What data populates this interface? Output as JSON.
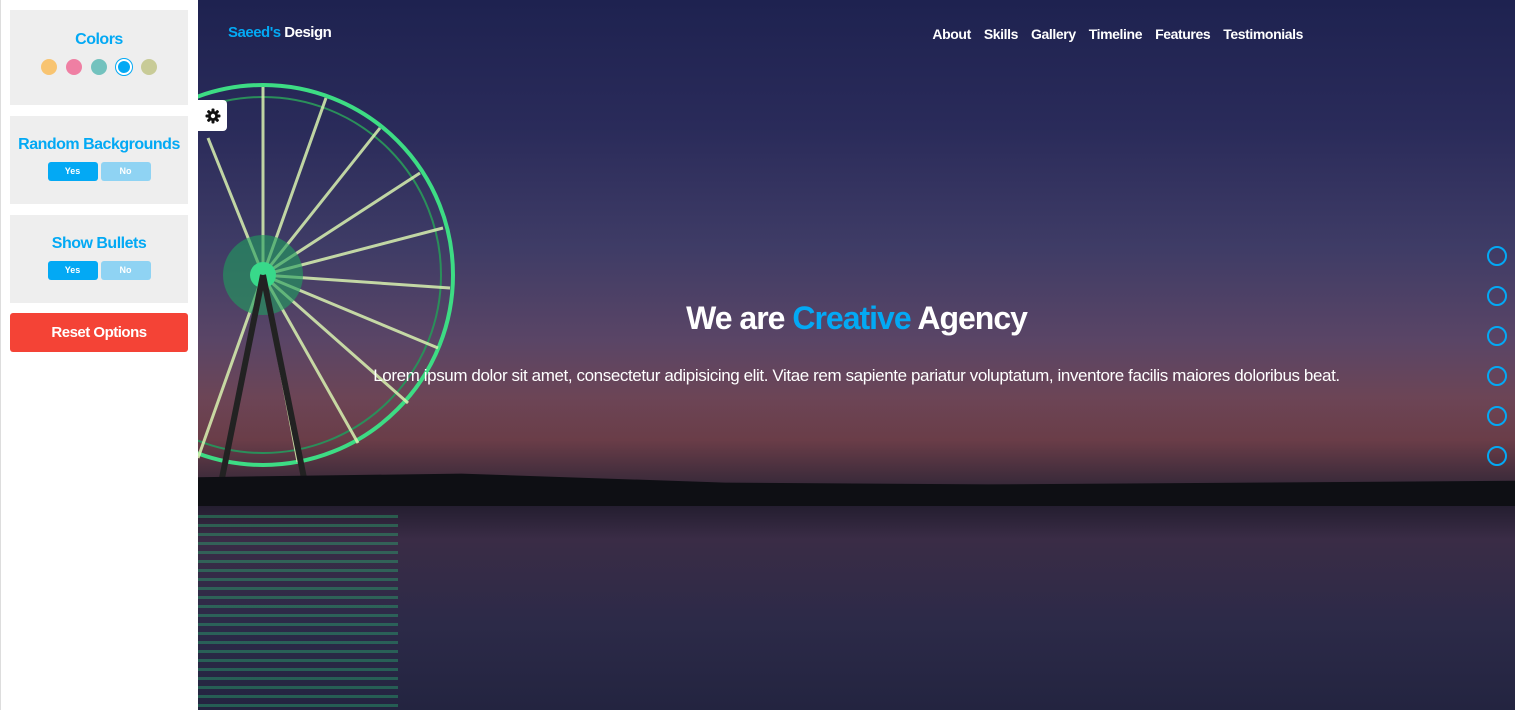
{
  "settings": {
    "colors": {
      "title": "Colors",
      "swatches": [
        "#f8c471",
        "#ef7fa3",
        "#73c2be",
        "#03a9f4",
        "#c8cb97"
      ],
      "active_index": 3
    },
    "random_backgrounds": {
      "title": "Random Backgrounds",
      "yes": "Yes",
      "no": "No"
    },
    "show_bullets": {
      "title": "Show Bullets",
      "yes": "Yes",
      "no": "No"
    },
    "reset_label": "Reset Options"
  },
  "header": {
    "logo_accent": "Saeed's",
    "logo_rest": "Design",
    "nav": [
      "About",
      "Skills",
      "Gallery",
      "Timeline",
      "Features",
      "Testimonials"
    ]
  },
  "hero": {
    "headline_pre": "We are",
    "headline_accent": "Creative",
    "headline_post": "Agency",
    "subtitle": "Lorem ipsum dolor sit amet, consectetur adipisicing elit. Vitae rem sapiente pariatur voluptatum, inventore facilis maiores doloribus beat."
  },
  "bullets_count": 6,
  "theme": {
    "accent": "#03a9f4",
    "reset": "#f44336"
  }
}
